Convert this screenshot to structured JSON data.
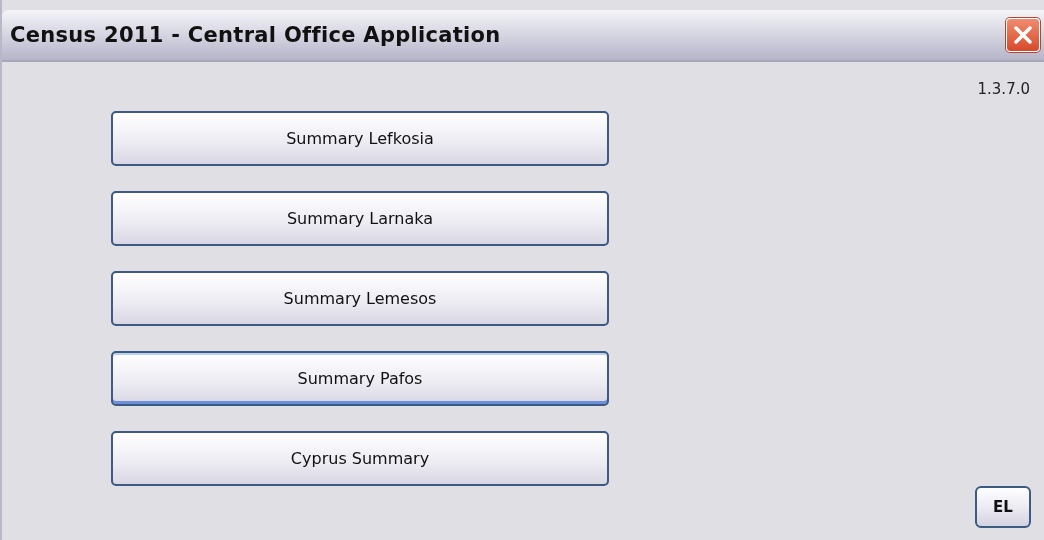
{
  "window": {
    "title": "Census 2011 - Central Office Application"
  },
  "version": "1.3.7.0",
  "buttons": [
    {
      "label": "Summary Lefkosia",
      "focused": false
    },
    {
      "label": "Summary Larnaka",
      "focused": false
    },
    {
      "label": "Summary Lemesos",
      "focused": false
    },
    {
      "label": "Summary Pafos",
      "focused": true
    },
    {
      "label": "Cyprus Summary",
      "focused": false
    }
  ],
  "language_button": {
    "label": "EL"
  }
}
